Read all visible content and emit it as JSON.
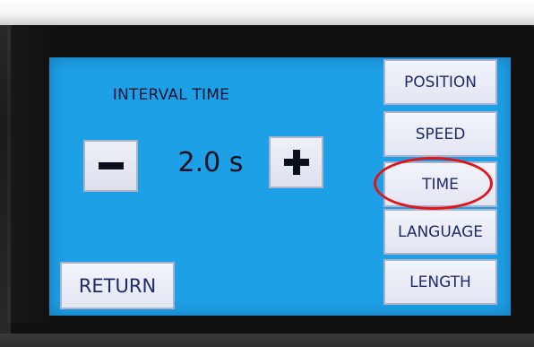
{
  "screen": {
    "title": "INTERVAL TIME",
    "interval_value": "2.0 s",
    "background_color": "#1ea0e6"
  },
  "stepper": {
    "decrement_icon": "minus-icon",
    "increment_icon": "plus-icon"
  },
  "side_menu": {
    "items": [
      {
        "label": "POSITION"
      },
      {
        "label": "SPEED"
      },
      {
        "label": "TIME",
        "highlighted": true
      },
      {
        "label": "LANGUAGE"
      },
      {
        "label": "LENGTH"
      }
    ]
  },
  "footer": {
    "return_label": "RETURN"
  },
  "annotation": {
    "ring_color": "#e2141b",
    "target": "TIME"
  }
}
